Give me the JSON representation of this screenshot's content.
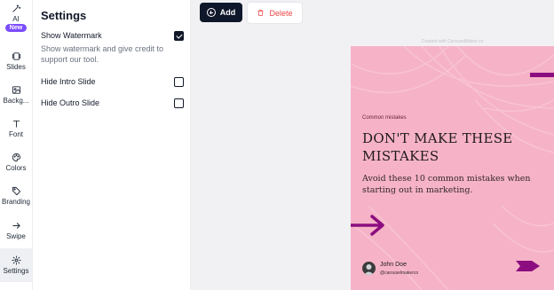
{
  "sidebar": {
    "items": [
      {
        "label": "AI",
        "icon": "magic-wand-icon",
        "badge": "New"
      },
      {
        "label": "Slides",
        "icon": "slides-icon"
      },
      {
        "label": "Backg...",
        "icon": "image-icon"
      },
      {
        "label": "Font",
        "icon": "text-icon"
      },
      {
        "label": "Colors",
        "icon": "palette-icon"
      },
      {
        "label": "Branding",
        "icon": "tag-icon"
      },
      {
        "label": "Swipe",
        "icon": "arrow-right-icon"
      },
      {
        "label": "Settings",
        "icon": "gear-icon"
      }
    ],
    "active": "Settings"
  },
  "settings": {
    "title": "Settings",
    "options": [
      {
        "label": "Show Watermark",
        "description": "Show watermark and give credit to support our tool.",
        "checked": true
      },
      {
        "label": "Hide Intro Slide",
        "checked": false
      },
      {
        "label": "Hide Outro Slide",
        "checked": false
      }
    ]
  },
  "toolbar": {
    "add_label": "Add",
    "delete_label": "Delete"
  },
  "slide": {
    "watermark": "Created with CarouselMaker.co",
    "tag": "Common mistakes",
    "headline": "DON'T MAKE THESE MISTAKES",
    "subtitle": "Avoid these 10 common mistakes when starting out in marketing.",
    "author_name": "John Doe",
    "author_handle": "@carouselmakerco",
    "background_color": "#f6b3c7",
    "accent_color": "#8b0d7f"
  },
  "colors": {
    "badge": "#7c4dff",
    "add_button": "#0f172a",
    "delete_text": "#ef4444"
  }
}
